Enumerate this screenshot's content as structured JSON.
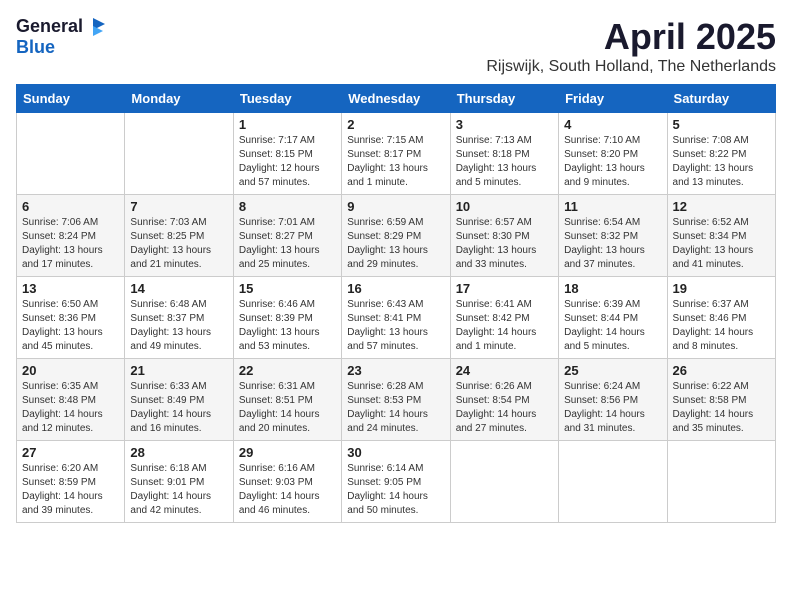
{
  "header": {
    "logo_general": "General",
    "logo_blue": "Blue",
    "month_title": "April 2025",
    "location": "Rijswijk, South Holland, The Netherlands"
  },
  "days_of_week": [
    "Sunday",
    "Monday",
    "Tuesday",
    "Wednesday",
    "Thursday",
    "Friday",
    "Saturday"
  ],
  "weeks": [
    [
      {
        "day": "",
        "info": ""
      },
      {
        "day": "",
        "info": ""
      },
      {
        "day": "1",
        "info": "Sunrise: 7:17 AM\nSunset: 8:15 PM\nDaylight: 12 hours and 57 minutes."
      },
      {
        "day": "2",
        "info": "Sunrise: 7:15 AM\nSunset: 8:17 PM\nDaylight: 13 hours and 1 minute."
      },
      {
        "day": "3",
        "info": "Sunrise: 7:13 AM\nSunset: 8:18 PM\nDaylight: 13 hours and 5 minutes."
      },
      {
        "day": "4",
        "info": "Sunrise: 7:10 AM\nSunset: 8:20 PM\nDaylight: 13 hours and 9 minutes."
      },
      {
        "day": "5",
        "info": "Sunrise: 7:08 AM\nSunset: 8:22 PM\nDaylight: 13 hours and 13 minutes."
      }
    ],
    [
      {
        "day": "6",
        "info": "Sunrise: 7:06 AM\nSunset: 8:24 PM\nDaylight: 13 hours and 17 minutes."
      },
      {
        "day": "7",
        "info": "Sunrise: 7:03 AM\nSunset: 8:25 PM\nDaylight: 13 hours and 21 minutes."
      },
      {
        "day": "8",
        "info": "Sunrise: 7:01 AM\nSunset: 8:27 PM\nDaylight: 13 hours and 25 minutes."
      },
      {
        "day": "9",
        "info": "Sunrise: 6:59 AM\nSunset: 8:29 PM\nDaylight: 13 hours and 29 minutes."
      },
      {
        "day": "10",
        "info": "Sunrise: 6:57 AM\nSunset: 8:30 PM\nDaylight: 13 hours and 33 minutes."
      },
      {
        "day": "11",
        "info": "Sunrise: 6:54 AM\nSunset: 8:32 PM\nDaylight: 13 hours and 37 minutes."
      },
      {
        "day": "12",
        "info": "Sunrise: 6:52 AM\nSunset: 8:34 PM\nDaylight: 13 hours and 41 minutes."
      }
    ],
    [
      {
        "day": "13",
        "info": "Sunrise: 6:50 AM\nSunset: 8:36 PM\nDaylight: 13 hours and 45 minutes."
      },
      {
        "day": "14",
        "info": "Sunrise: 6:48 AM\nSunset: 8:37 PM\nDaylight: 13 hours and 49 minutes."
      },
      {
        "day": "15",
        "info": "Sunrise: 6:46 AM\nSunset: 8:39 PM\nDaylight: 13 hours and 53 minutes."
      },
      {
        "day": "16",
        "info": "Sunrise: 6:43 AM\nSunset: 8:41 PM\nDaylight: 13 hours and 57 minutes."
      },
      {
        "day": "17",
        "info": "Sunrise: 6:41 AM\nSunset: 8:42 PM\nDaylight: 14 hours and 1 minute."
      },
      {
        "day": "18",
        "info": "Sunrise: 6:39 AM\nSunset: 8:44 PM\nDaylight: 14 hours and 5 minutes."
      },
      {
        "day": "19",
        "info": "Sunrise: 6:37 AM\nSunset: 8:46 PM\nDaylight: 14 hours and 8 minutes."
      }
    ],
    [
      {
        "day": "20",
        "info": "Sunrise: 6:35 AM\nSunset: 8:48 PM\nDaylight: 14 hours and 12 minutes."
      },
      {
        "day": "21",
        "info": "Sunrise: 6:33 AM\nSunset: 8:49 PM\nDaylight: 14 hours and 16 minutes."
      },
      {
        "day": "22",
        "info": "Sunrise: 6:31 AM\nSunset: 8:51 PM\nDaylight: 14 hours and 20 minutes."
      },
      {
        "day": "23",
        "info": "Sunrise: 6:28 AM\nSunset: 8:53 PM\nDaylight: 14 hours and 24 minutes."
      },
      {
        "day": "24",
        "info": "Sunrise: 6:26 AM\nSunset: 8:54 PM\nDaylight: 14 hours and 27 minutes."
      },
      {
        "day": "25",
        "info": "Sunrise: 6:24 AM\nSunset: 8:56 PM\nDaylight: 14 hours and 31 minutes."
      },
      {
        "day": "26",
        "info": "Sunrise: 6:22 AM\nSunset: 8:58 PM\nDaylight: 14 hours and 35 minutes."
      }
    ],
    [
      {
        "day": "27",
        "info": "Sunrise: 6:20 AM\nSunset: 8:59 PM\nDaylight: 14 hours and 39 minutes."
      },
      {
        "day": "28",
        "info": "Sunrise: 6:18 AM\nSunset: 9:01 PM\nDaylight: 14 hours and 42 minutes."
      },
      {
        "day": "29",
        "info": "Sunrise: 6:16 AM\nSunset: 9:03 PM\nDaylight: 14 hours and 46 minutes."
      },
      {
        "day": "30",
        "info": "Sunrise: 6:14 AM\nSunset: 9:05 PM\nDaylight: 14 hours and 50 minutes."
      },
      {
        "day": "",
        "info": ""
      },
      {
        "day": "",
        "info": ""
      },
      {
        "day": "",
        "info": ""
      }
    ]
  ]
}
